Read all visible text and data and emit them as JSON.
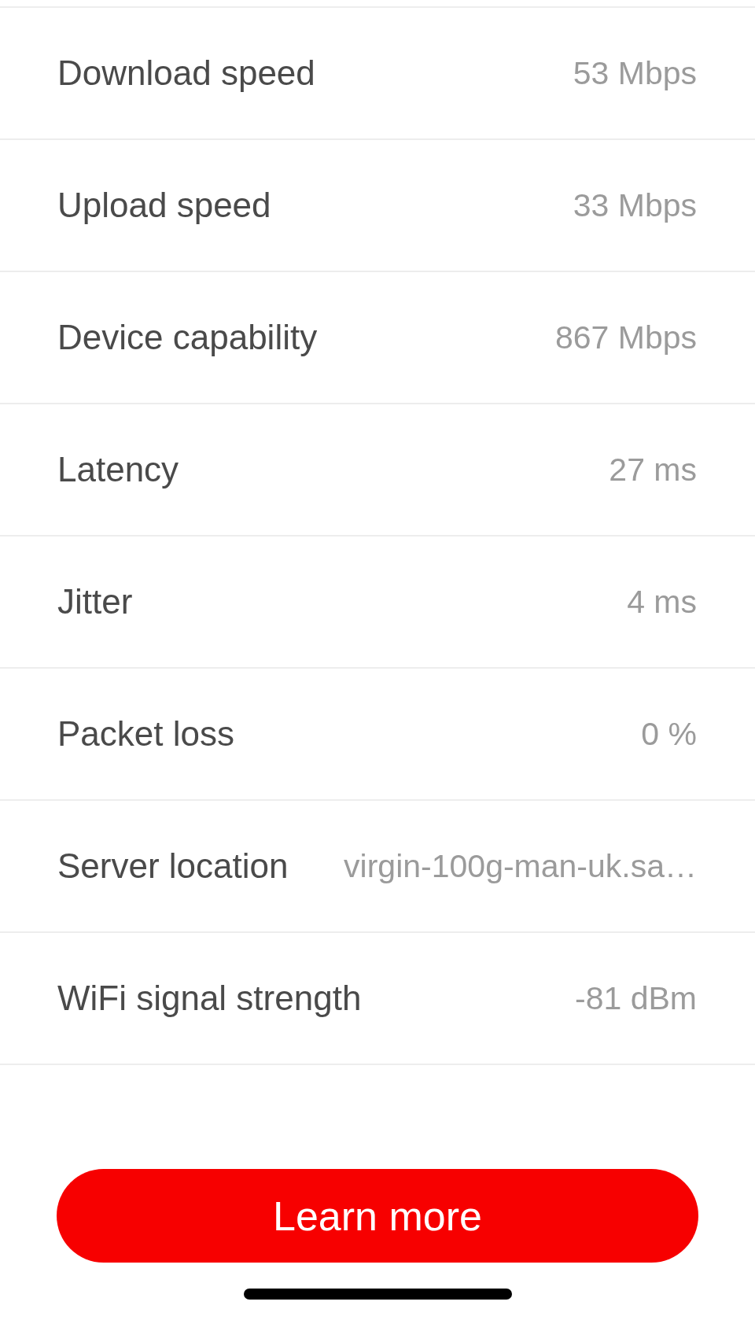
{
  "rows": [
    {
      "label": "Download speed",
      "value": "53 Mbps"
    },
    {
      "label": "Upload speed",
      "value": "33 Mbps"
    },
    {
      "label": "Device capability",
      "value": "867 Mbps"
    },
    {
      "label": "Latency",
      "value": "27 ms"
    },
    {
      "label": "Jitter",
      "value": "4 ms"
    },
    {
      "label": "Packet loss",
      "value": "0 %"
    },
    {
      "label": "Server location",
      "value": "virgin-100g-man-uk.sa…"
    },
    {
      "label": "WiFi signal strength",
      "value": "-81 dBm"
    }
  ],
  "button": {
    "label": "Learn more"
  }
}
